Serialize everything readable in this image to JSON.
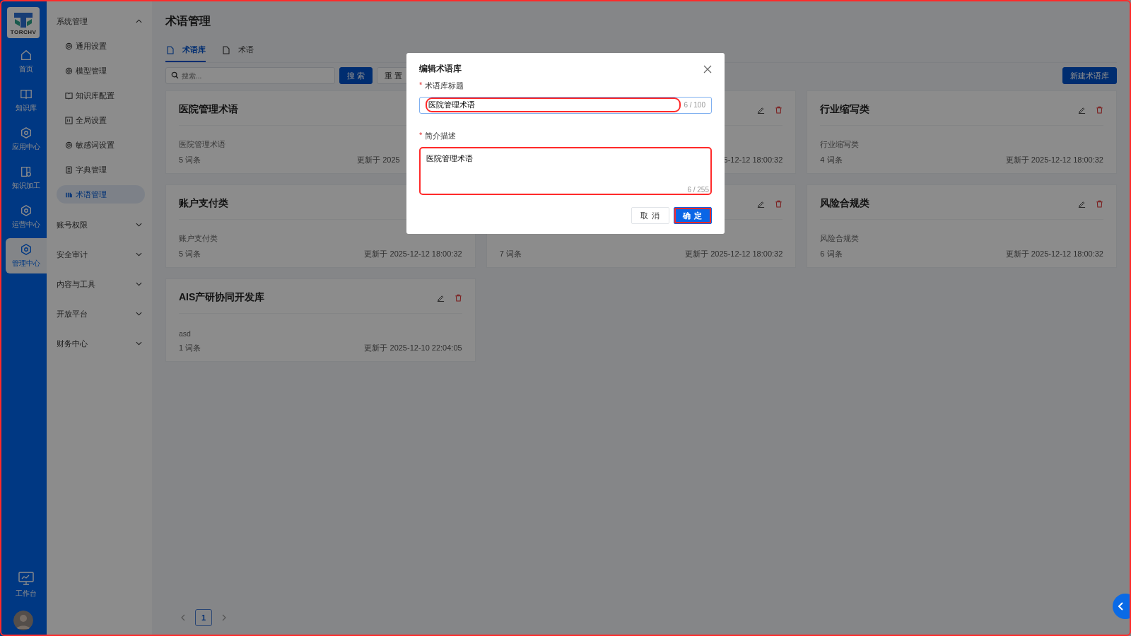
{
  "annotation_frame": true,
  "rail": {
    "logo_text": "TORCHV",
    "items": [
      {
        "label": "首页",
        "selected": false
      },
      {
        "label": "知识库",
        "selected": false
      },
      {
        "label": "应用中心",
        "selected": false
      },
      {
        "label": "知识加工",
        "selected": false
      },
      {
        "label": "运营中心",
        "selected": false
      },
      {
        "label": "管理中心",
        "selected": true
      }
    ],
    "bottom_item": {
      "label": "工作台"
    }
  },
  "menu": [
    {
      "label": "系统管理",
      "expanded": true,
      "children": [
        {
          "label": "通用设置",
          "selected": false
        },
        {
          "label": "模型管理",
          "selected": false
        },
        {
          "label": "知识库配置",
          "selected": false
        },
        {
          "label": "全局设置",
          "selected": false
        },
        {
          "label": "敏感词设置",
          "selected": false
        },
        {
          "label": "字典管理",
          "selected": false
        },
        {
          "label": "术语管理",
          "selected": true
        }
      ]
    },
    {
      "label": "账号权限",
      "expanded": false
    },
    {
      "label": "安全审计",
      "expanded": false
    },
    {
      "label": "内容与工具",
      "expanded": false
    },
    {
      "label": "开放平台",
      "expanded": false
    },
    {
      "label": "财务中心",
      "expanded": false
    }
  ],
  "page": {
    "title": "术语管理",
    "tabs": [
      {
        "label": "术语库",
        "selected": true
      },
      {
        "label": "术语",
        "selected": false
      }
    ],
    "search": {
      "placeholder": "搜索..."
    },
    "search_button": "搜 索",
    "reset_button": "重 置",
    "new_button": "新建术语库"
  },
  "cards": [
    {
      "title": "医院管理术语",
      "description": "医院管理术语",
      "count": "5 词条",
      "updated": "更新于 2025",
      "clipped_end": true
    },
    {
      "updated": "5-12-12 18:00:32",
      "actions": true
    },
    {
      "title": "行业缩写类",
      "description": "行业缩写类",
      "count": "4 词条",
      "updated": "更新于 2025-12-12 18:00:32",
      "actions": true
    },
    {
      "title": "账户支付类",
      "description": "账户支付类",
      "count": "5 词条",
      "updated": "更新于 2025-12-12 18:00:32"
    },
    {
      "count": "7 词条",
      "updated": "更新于 2025-12-12 18:00:32",
      "actions": true
    },
    {
      "title": "风险合规类",
      "description": "风险合规类",
      "count": "6 词条",
      "updated": "更新于 2025-12-12 18:00:32",
      "actions": true
    },
    {
      "title": "AIS产研协同开发库",
      "description": "asd",
      "count": "1 词条",
      "updated": "更新于 2025-12-10 22:04:05",
      "actions": true
    }
  ],
  "pagination": {
    "pages": [
      {
        "label": "1",
        "selected": true
      }
    ]
  },
  "modal": {
    "title": "编辑术语库",
    "fields": [
      {
        "kind": "input",
        "label": "术语库标题",
        "required_mark": "*",
        "value": "医院管理术语",
        "counter": "6 / 100",
        "highlighted": true
      },
      {
        "kind": "textarea",
        "label": "简介描述",
        "required_mark": "*",
        "value": "医院管理术语",
        "counter": "6 / 255",
        "highlighted": true
      }
    ],
    "buttons": [
      {
        "label": "取 消",
        "primary": false,
        "highlighted": false
      },
      {
        "label": "确 定",
        "primary": true,
        "highlighted": true
      }
    ]
  }
}
